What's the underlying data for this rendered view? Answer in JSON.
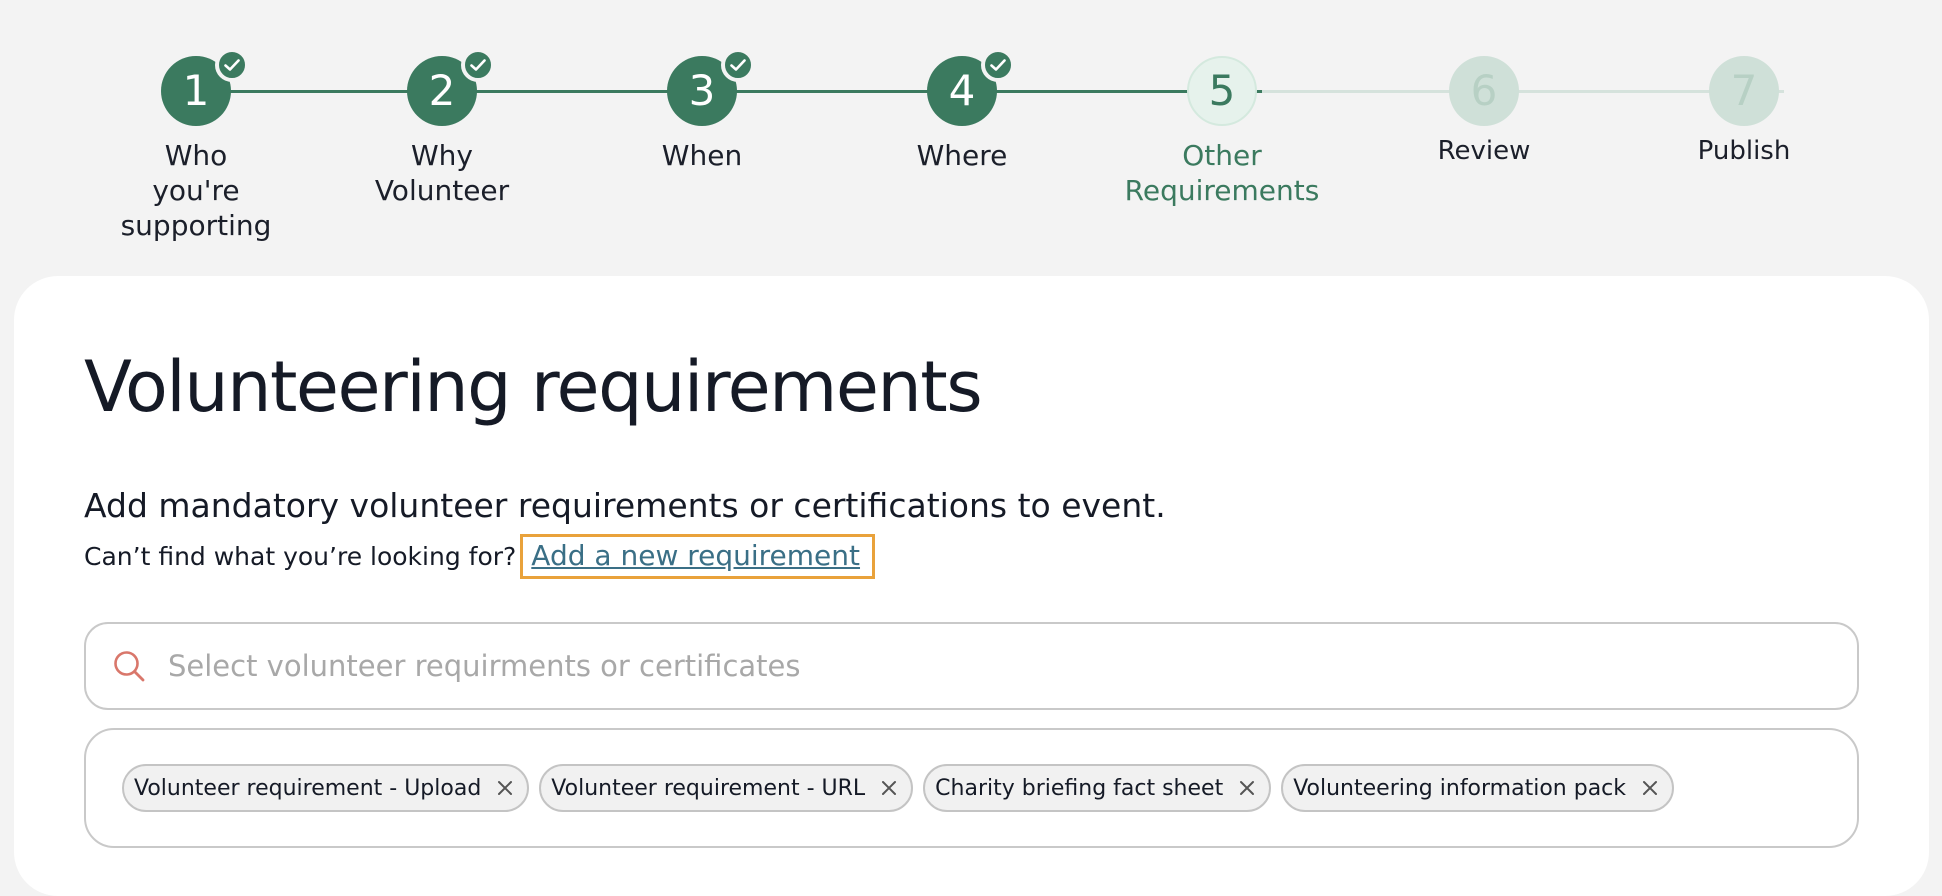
{
  "stepper": {
    "steps": [
      {
        "number": "1",
        "label_lines": [
          "Who",
          "you're",
          "supporting"
        ],
        "status": "done"
      },
      {
        "number": "2",
        "label_lines": [
          "Why",
          "Volunteer"
        ],
        "status": "done"
      },
      {
        "number": "3",
        "label_lines": [
          "When"
        ],
        "status": "done"
      },
      {
        "number": "4",
        "label_lines": [
          "Where"
        ],
        "status": "done"
      },
      {
        "number": "5",
        "label_lines": [
          "Other",
          "Requirements"
        ],
        "status": "current"
      },
      {
        "number": "6",
        "label_lines": [
          "Review"
        ],
        "status": "todo"
      },
      {
        "number": "7",
        "label_lines": [
          "Publish"
        ],
        "status": "todo"
      }
    ]
  },
  "main": {
    "title": "Volunteering requirements",
    "subheading": "Add mandatory volunteer requirements or certifications to event.",
    "helper_text": "Can’t find what you’re looking for?",
    "add_link_label": "Add a new requirement",
    "search": {
      "placeholder": "Select volunteer requirments or certificates",
      "value": ""
    },
    "selected_chips": [
      "Volunteer requirement - Upload",
      "Volunteer requirement - URL",
      "Charity briefing fact sheet",
      "Volunteering information pack"
    ]
  },
  "colors": {
    "accent_green": "#3b7a5f",
    "link_blue": "#3a6f86",
    "highlight_orange": "#e9a23b",
    "search_icon": "#d9776b"
  },
  "icons": {
    "step_done": "check-icon",
    "search": "search-icon",
    "chip_remove": "close-icon"
  }
}
